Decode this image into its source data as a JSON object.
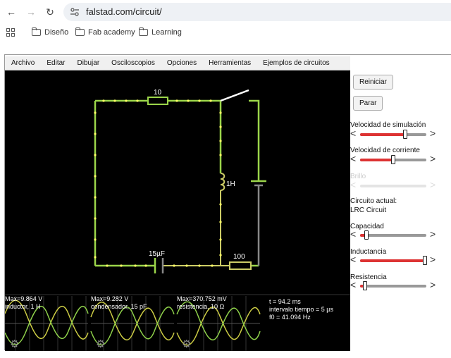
{
  "browser": {
    "url": "falstad.com/circuit/",
    "bookmarks": [
      "Diseño",
      "Fab academy",
      "Learning"
    ]
  },
  "menu": [
    "Archivo",
    "Editar",
    "Dibujar",
    "Osciloscopios",
    "Opciones",
    "Herramientas",
    "Ejemplos de circuitos"
  ],
  "circuit": {
    "resistor_top": "10",
    "inductor": "1H",
    "capacitor": "15µF",
    "resistor_bottom": "100"
  },
  "scopes": [
    {
      "max": "Max=9.864 V",
      "desc": "inductor, 1 H"
    },
    {
      "max": "Max=9.282 V",
      "desc": "condensador, 15 pF"
    },
    {
      "max": "Max=370.752 mV",
      "desc": "resistencia, 10 Ω"
    }
  ],
  "info": {
    "time": "t = 94.2 ms",
    "interval": "intervalo tiempo = 5 µs",
    "f0": "f0 = 41.094 Hz"
  },
  "panel": {
    "reset_label": "Reiniciar",
    "stop_label": "Parar",
    "sim_speed_label": "Velocidad de simulación",
    "sim_speed": 0.68,
    "current_speed_label": "Velocidad de corriente",
    "current_speed": 0.5,
    "brightness_label": "Brillo",
    "brightness": 0.5,
    "current_circuit_label": "Circuito actual:",
    "current_circuit_name": "LRC Circuit",
    "capacitance_label": "Capacidad",
    "capacitance": 0.1,
    "inductance_label": "Inductancia",
    "inductance": 0.98,
    "resistance_label": "Resistencia",
    "resistance": 0.07
  },
  "colors": {
    "wire": "#9bd54a",
    "wire_dim": "#888888",
    "dot": "#ffff66",
    "slider_fill": "#dd3333"
  }
}
